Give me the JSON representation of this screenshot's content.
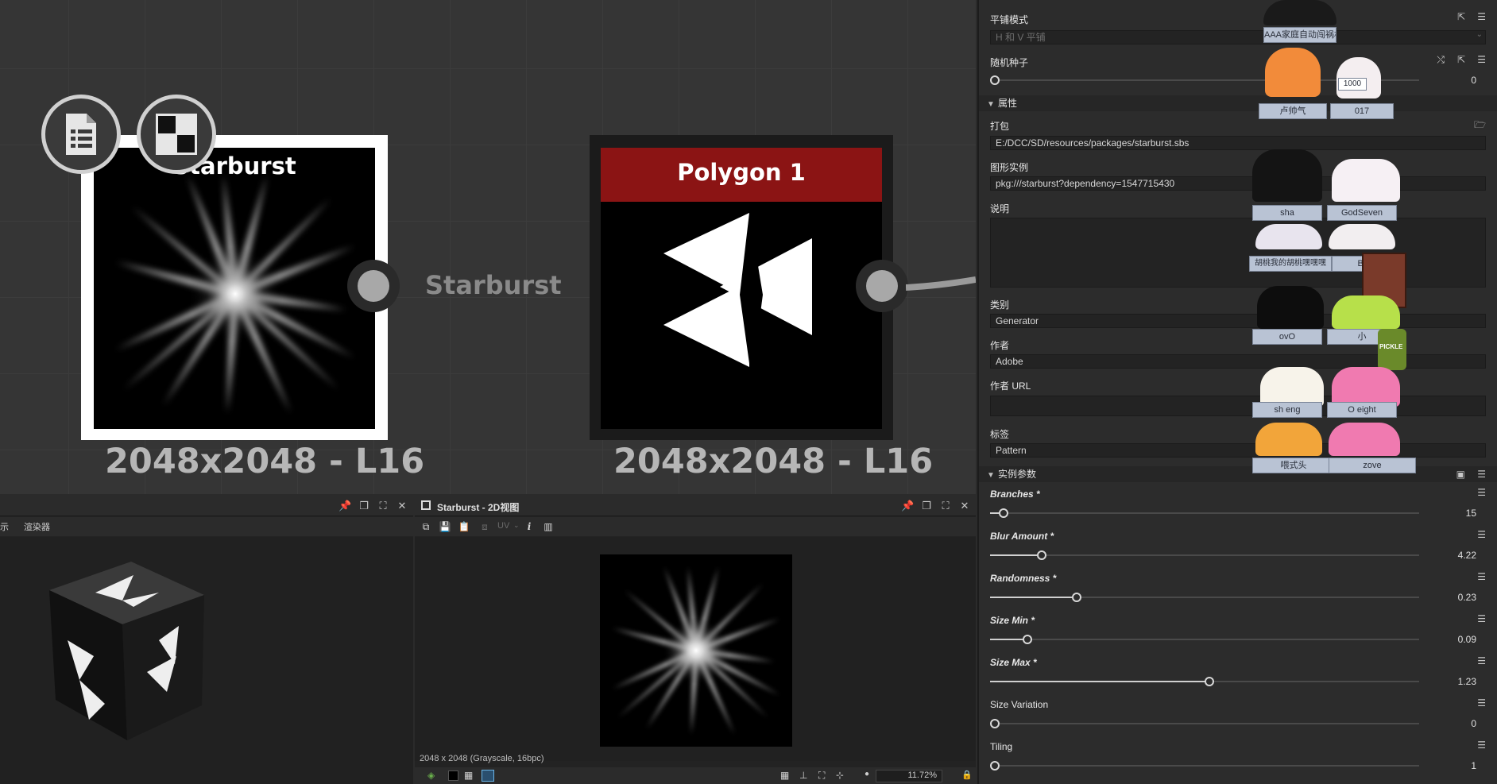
{
  "graph": {
    "starburst_node": {
      "title": "Starburst",
      "resolution": "2048x2048 - L16",
      "output_label": "Starburst"
    },
    "polygon_node": {
      "title": "Polygon 1",
      "resolution": "2048x2048 - L16",
      "header_color": "#8b1414"
    }
  },
  "panel_3d": {
    "tab_fragment": "示",
    "tab_renderer": "渲染器"
  },
  "panel_2d": {
    "title": "Starburst - 2D视图",
    "uv_label": "UV",
    "info_icon": "i",
    "status": "2048 x 2048 (Grayscale, 16bpc)",
    "zoom": "11.72%"
  },
  "props": {
    "tiling_mode_label": "平铺模式",
    "tiling_mode_value": "H 和 V 平铺",
    "random_seed_label": "随机种子",
    "random_seed_value": "0",
    "section_attributes": "属性",
    "package_label": "打包",
    "package_value": "E:/DCC/SD/resources/packages/starburst.sbs",
    "graph_instance_label": "图形实例",
    "graph_instance_value": "pkg:///starburst?dependency=1547715430",
    "description_label": "说明",
    "category_label": "类别",
    "category_value": "Generator",
    "author_label": "作者",
    "author_value": "Adobe",
    "author_url_label": "作者 URL",
    "tags_label": "标签",
    "tags_value": "Pattern",
    "section_instance_params": "实例参数",
    "params": [
      {
        "label": "Branches *",
        "value": "15",
        "fraction": 0.02,
        "italic": true
      },
      {
        "label": "Blur Amount *",
        "value": "4.22",
        "fraction": 0.11,
        "italic": true
      },
      {
        "label": "Randomness *",
        "value": "0.23",
        "fraction": 0.19,
        "italic": true
      },
      {
        "label": "Size Min *",
        "value": "0.09",
        "fraction": 0.075,
        "italic": true
      },
      {
        "label": "Size Max *",
        "value": "1.23",
        "fraction": 0.5,
        "italic": true
      },
      {
        "label": "Size Variation",
        "value": "0",
        "fraction": 0.0,
        "italic": false
      },
      {
        "label": "Tiling",
        "value": "1",
        "fraction": 0.0,
        "italic": false
      }
    ]
  },
  "overlay_cats": {
    "tags": [
      "AAA家庭自动闯祸机",
      "卢帅气",
      "017",
      "sha",
      "GodSeven",
      "胡桃我的胡桃嘿嘿嘿",
      "Bor",
      "ovO",
      "小",
      "sh   eng",
      "O   eight",
      "喂式头",
      "zove"
    ],
    "badge_1000": "1000",
    "pickle_label": "PICKLE"
  },
  "colors": {
    "accent_red": "#8b1414",
    "node_selected": "#ffffff"
  }
}
